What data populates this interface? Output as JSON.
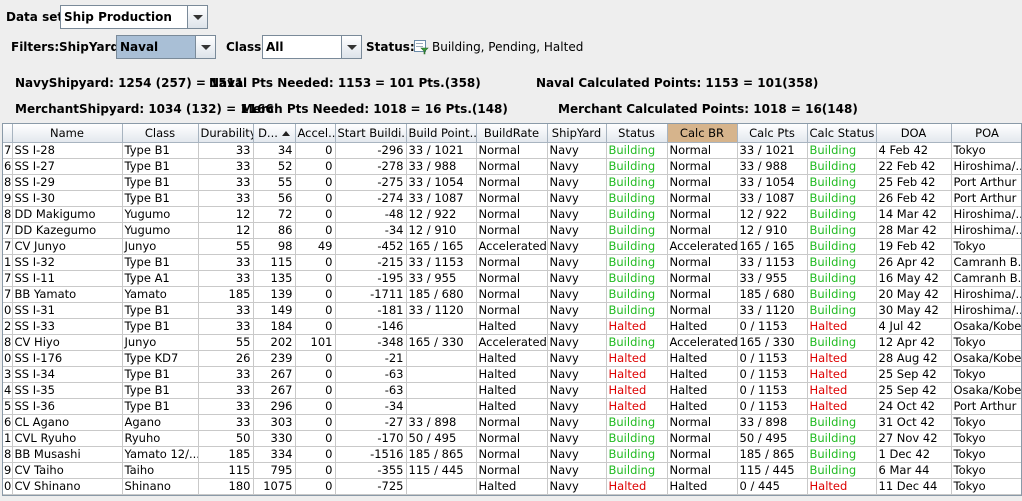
{
  "dataset": {
    "label": "Data set:",
    "value": "Ship Production"
  },
  "filters": {
    "label": "Filters:",
    "shipyard_label": "ShipYard:",
    "shipyard_value": "Naval",
    "class_label": "Class:",
    "class_value": "All",
    "status_label": "Status:",
    "status_value": "Building, Pending, Halted"
  },
  "stats": {
    "navy_shipyard": "NavyShipyard: 1254 (257) = 1511",
    "naval_pts_needed_label": "Naval Pts Needed: 1153",
    "naval_pts_needed_value": "= 101 Pts.(358)",
    "naval_calc_points": "Naval Calculated Points:  1153 = 101(358)",
    "merchant_shipyard": "MerchantShipyard: 1034 (132) = 1166",
    "merch_pts_needed_label": "Merch Pts Needed: 1018",
    "merch_pts_needed_value": "= 16 Pts.(148)",
    "merchant_calc_points": "Merchant Calculated Points:  1018 = 16(148)"
  },
  "table": {
    "columns": [
      "",
      "Name",
      "Class",
      "Durability",
      "D...",
      "Accel...",
      "Start Buildi...",
      "Build Point...",
      "BuildRate",
      "ShipYard",
      "Status",
      "Calc BR",
      "Calc Pts",
      "Calc Status",
      "DOA",
      "POA"
    ],
    "rows": [
      [
        "7",
        "SS I-28",
        "Type B1",
        "33",
        "34",
        "0",
        "-296",
        "33 / 1021",
        "Normal",
        "Navy",
        "Building",
        "Normal",
        "33 / 1021",
        "Building",
        "4 Feb 42",
        "Tokyo"
      ],
      [
        "6",
        "SS I-27",
        "Type B1",
        "33",
        "52",
        "0",
        "-278",
        "33 / 988",
        "Normal",
        "Navy",
        "Building",
        "Normal",
        "33 / 988",
        "Building",
        "22 Feb 42",
        "Hiroshima/..."
      ],
      [
        "8",
        "SS I-29",
        "Type B1",
        "33",
        "55",
        "0",
        "-275",
        "33 / 1054",
        "Normal",
        "Navy",
        "Building",
        "Normal",
        "33 / 1054",
        "Building",
        "25 Feb 42",
        "Port Arthur"
      ],
      [
        "9",
        "SS I-30",
        "Type B1",
        "33",
        "56",
        "0",
        "-274",
        "33 / 1087",
        "Normal",
        "Navy",
        "Building",
        "Normal",
        "33 / 1087",
        "Building",
        "26 Feb 42",
        "Port Arthur"
      ],
      [
        "8",
        "DD Makigumo",
        "Yugumo",
        "12",
        "72",
        "0",
        "-48",
        "12 / 922",
        "Normal",
        "Navy",
        "Building",
        "Normal",
        "12 / 922",
        "Building",
        "14 Mar 42",
        "Hiroshima/..."
      ],
      [
        "7",
        "DD Kazegumo",
        "Yugumo",
        "12",
        "86",
        "0",
        "-34",
        "12 / 910",
        "Normal",
        "Navy",
        "Building",
        "Normal",
        "12 / 910",
        "Building",
        "28 Mar 42",
        "Hiroshima/..."
      ],
      [
        "7",
        "CV Junyo",
        "Junyo",
        "55",
        "98",
        "49",
        "-452",
        "165 / 165",
        "Accelerated",
        "Navy",
        "Building",
        "Accelerated",
        "165 / 165",
        "Building",
        "19 Feb 42",
        "Tokyo"
      ],
      [
        "1",
        "SS I-32",
        "Type B1",
        "33",
        "115",
        "0",
        "-215",
        "33 / 1153",
        "Normal",
        "Navy",
        "Building",
        "Normal",
        "33 / 1153",
        "Building",
        "26 Apr 42",
        "Camranh B..."
      ],
      [
        "7",
        "SS I-11",
        "Type A1",
        "33",
        "135",
        "0",
        "-195",
        "33 / 955",
        "Normal",
        "Navy",
        "Building",
        "Normal",
        "33 / 955",
        "Building",
        "16 May 42",
        "Camranh B..."
      ],
      [
        "7",
        "BB Yamato",
        "Yamato",
        "185",
        "139",
        "0",
        "-1711",
        "185 / 680",
        "Normal",
        "Navy",
        "Building",
        "Normal",
        "185 / 680",
        "Building",
        "20 May 42",
        "Hiroshima/..."
      ],
      [
        "0",
        "SS I-31",
        "Type B1",
        "33",
        "149",
        "0",
        "-181",
        "33 / 1120",
        "Normal",
        "Navy",
        "Building",
        "Normal",
        "33 / 1120",
        "Building",
        "30 May 42",
        "Hiroshima/..."
      ],
      [
        "2",
        "SS I-33",
        "Type B1",
        "33",
        "184",
        "0",
        "-146",
        "",
        "Halted",
        "Navy",
        "Halted",
        "Halted",
        "0 / 1153",
        "Halted",
        "4 Jul 42",
        "Osaka/Kobe"
      ],
      [
        "8",
        "CV Hiyo",
        "Junyo",
        "55",
        "202",
        "101",
        "-348",
        "165 / 330",
        "Accelerated",
        "Navy",
        "Building",
        "Accelerated",
        "165 / 330",
        "Building",
        "12 Apr 42",
        "Tokyo"
      ],
      [
        "0",
        "SS I-176",
        "Type KD7",
        "26",
        "239",
        "0",
        "-21",
        "",
        "Halted",
        "Navy",
        "Halted",
        "Halted",
        "0 / 1153",
        "Halted",
        "28 Aug 42",
        "Osaka/Kobe"
      ],
      [
        "3",
        "SS I-34",
        "Type B1",
        "33",
        "267",
        "0",
        "-63",
        "",
        "Halted",
        "Navy",
        "Halted",
        "Halted",
        "0 / 1153",
        "Halted",
        "25 Sep 42",
        "Tokyo"
      ],
      [
        "4",
        "SS I-35",
        "Type B1",
        "33",
        "267",
        "0",
        "-63",
        "",
        "Halted",
        "Navy",
        "Halted",
        "Halted",
        "0 / 1153",
        "Halted",
        "25 Sep 42",
        "Osaka/Kobe"
      ],
      [
        "5",
        "SS I-36",
        "Type B1",
        "33",
        "296",
        "0",
        "-34",
        "",
        "Halted",
        "Navy",
        "Halted",
        "Halted",
        "0 / 1153",
        "Halted",
        "24 Oct 42",
        "Port Arthur"
      ],
      [
        "6",
        "CL Agano",
        "Agano",
        "33",
        "303",
        "0",
        "-27",
        "33 / 898",
        "Normal",
        "Navy",
        "Building",
        "Normal",
        "33 / 898",
        "Building",
        "31 Oct 42",
        "Tokyo"
      ],
      [
        "1",
        "CVL Ryuho",
        "Ryuho",
        "50",
        "330",
        "0",
        "-170",
        "50 / 495",
        "Normal",
        "Navy",
        "Building",
        "Normal",
        "50 / 495",
        "Building",
        "27 Nov 42",
        "Tokyo"
      ],
      [
        "8",
        "BB Musashi",
        "Yamato 12/...",
        "185",
        "334",
        "0",
        "-1516",
        "185 / 865",
        "Normal",
        "Navy",
        "Building",
        "Normal",
        "185 / 865",
        "Building",
        "1 Dec 42",
        "Tokyo"
      ],
      [
        "9",
        "CV Taiho",
        "Taiho",
        "115",
        "795",
        "0",
        "-355",
        "115 / 445",
        "Normal",
        "Navy",
        "Building",
        "Normal",
        "115 / 445",
        "Building",
        "6 Mar 44",
        "Tokyo"
      ],
      [
        "0",
        "CV Shinano",
        "Shinano",
        "180",
        "1075",
        "0",
        "-725",
        "",
        "Halted",
        "Navy",
        "Halted",
        "Halted",
        "0 / 445",
        "Halted",
        "11 Dec 44",
        "Tokyo"
      ]
    ]
  },
  "colors": {
    "building": "#22bb22",
    "halted": "#dd0000",
    "sorted_header": "#d6b48c"
  },
  "icons": {
    "status_filter": "status-filter-icon",
    "sort": "sort-ascending-icon"
  }
}
